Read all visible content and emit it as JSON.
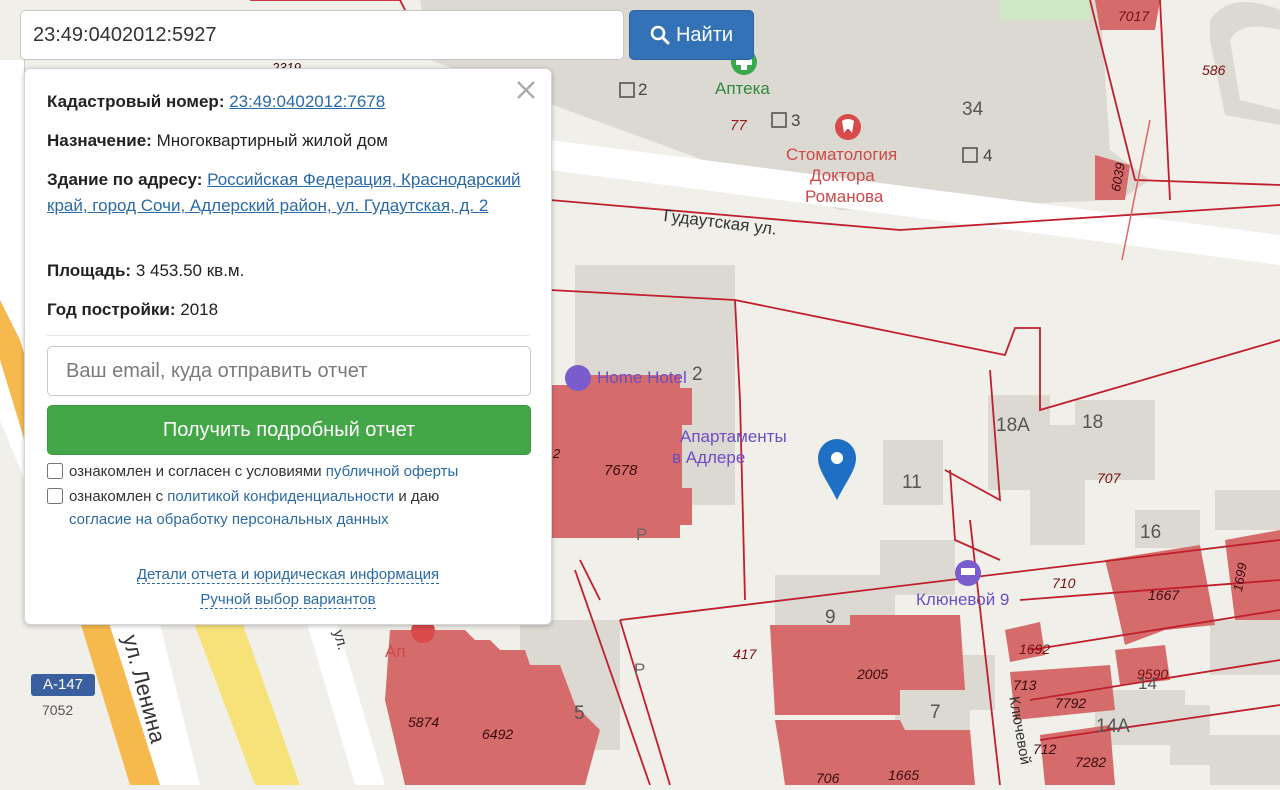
{
  "search": {
    "value": "23:49:0402012:5927",
    "button_label": "Найти"
  },
  "popup": {
    "cadastral_label": "Кадастровый номер:",
    "cadastral_value": "23:49:0402012:7678",
    "purpose_label": "Назначение:",
    "purpose_value": "Многоквартирный жилой дом",
    "address_label": "Здание по адресу:",
    "address_value": "Российская Федерация, Краснодарский край, город Сочи, Адлерский район, ул. Гудаутская, д. 2",
    "area_label": "Площадь:",
    "area_value": "3 453.50 кв.м.",
    "year_label": "Год постройки:",
    "year_value": "2018",
    "email_placeholder": "Ваш email, куда отправить отчет",
    "report_button": "Получить подробный отчет",
    "consent1_text": "ознакомлен и согласен с условиями",
    "consent1_link": "публичной оферты",
    "consent2_text1": "ознакомлен с",
    "consent2_link1": "политикой конфиденциальности",
    "consent2_text2": "и даю",
    "consent2_link2": "согласие на обработку персональных данных",
    "details_link": "Детали отчета и юридическая информация",
    "manual_link": "Ручной выбор вариантов"
  },
  "map": {
    "colors": {
      "background": "#f1efea",
      "building": "#dcd8d2",
      "parcel_fill": "#d56b6b",
      "parcel_line": "#c01f2c",
      "road": "#ffffff",
      "highway": "#f5b94d",
      "poi_green": "#3aa84f",
      "poi_red": "#d94b4b",
      "poi_purple": "#7a5ccc",
      "pin": "#1f6fc5"
    },
    "labels": [
      {
        "text": "Аптека",
        "color": "#2f8a3c",
        "size": 17
      },
      {
        "text": "77",
        "color": "#9a1b1b",
        "size": 15,
        "italic": true
      },
      {
        "text": "2",
        "color": "#444",
        "size": 17
      },
      {
        "text": "3",
        "color": "#444",
        "size": 17
      },
      {
        "text": "4",
        "color": "#444",
        "size": 17
      },
      {
        "text": "34",
        "color": "#555",
        "size": 19
      },
      {
        "text": "Стоматология",
        "color": "#cc4a4a",
        "size": 17
      },
      {
        "text": "Доктора",
        "color": "#cc4a4a",
        "size": 17
      },
      {
        "text": "Романова",
        "color": "#cc4a4a",
        "size": 17
      },
      {
        "text": "Гудаутская ул.",
        "color": "#333",
        "size": 17
      },
      {
        "text": "7017",
        "color": "#7a0e0e",
        "size": 14,
        "italic": true
      },
      {
        "text": "586",
        "color": "#7a0e0e",
        "size": 14,
        "italic": true
      },
      {
        "text": "Home Hotel",
        "color": "#6a4fc4",
        "size": 17
      },
      {
        "text": "2",
        "color": "#555",
        "size": 19
      },
      {
        "text": "Апартаменты",
        "color": "#6a4fc4",
        "size": 17
      },
      {
        "text": "в Адлере",
        "color": "#6a4fc4",
        "size": 17
      },
      {
        "text": "7678",
        "color": "#3a0a0a",
        "size": 15,
        "italic": true
      },
      {
        "text": "11",
        "color": "#555",
        "size": 19
      },
      {
        "text": "18А",
        "color": "#555",
        "size": 19
      },
      {
        "text": "18",
        "color": "#555",
        "size": 19
      },
      {
        "text": "707",
        "color": "#7a0e0e",
        "size": 14,
        "italic": true
      },
      {
        "text": "16",
        "color": "#555",
        "size": 19
      },
      {
        "text": "Клюневой 9",
        "color": "#6a4fc4",
        "size": 17
      },
      {
        "text": "710",
        "color": "#7a0e0e",
        "size": 14,
        "italic": true
      },
      {
        "text": "1667",
        "color": "#3a0a0a",
        "size": 14,
        "italic": true
      },
      {
        "text": "9",
        "color": "#555",
        "size": 19
      },
      {
        "text": "417",
        "color": "#7a0e0e",
        "size": 14,
        "italic": true
      },
      {
        "text": "2005",
        "color": "#3a0a0a",
        "size": 14,
        "italic": true
      },
      {
        "text": "1692",
        "color": "#7a0e0e",
        "size": 14,
        "italic": true
      },
      {
        "text": "9590",
        "color": "#7a0e0e",
        "size": 14,
        "italic": true
      },
      {
        "text": "713",
        "color": "#3a0a0a",
        "size": 14,
        "italic": true
      },
      {
        "text": "7792",
        "color": "#3a0a0a",
        "size": 14,
        "italic": true
      },
      {
        "text": "7",
        "color": "#555",
        "size": 19
      },
      {
        "text": "14А",
        "color": "#555",
        "size": 19
      },
      {
        "text": "712",
        "color": "#3a0a0a",
        "size": 14,
        "italic": true
      },
      {
        "text": "7282",
        "color": "#3a0a0a",
        "size": 14,
        "italic": true
      },
      {
        "text": "706",
        "color": "#3a0a0a",
        "size": 14,
        "italic": true
      },
      {
        "text": "1665",
        "color": "#3a0a0a",
        "size": 14,
        "italic": true
      },
      {
        "text": "5",
        "color": "#555",
        "size": 19
      },
      {
        "text": "5874",
        "color": "#3a0a0a",
        "size": 14,
        "italic": true
      },
      {
        "text": "6492",
        "color": "#3a0a0a",
        "size": 14,
        "italic": true
      },
      {
        "text": "7052",
        "color": "#555",
        "size": 14
      },
      {
        "text": "6039",
        "color": "#3a0a0a",
        "size": 13,
        "italic": true
      },
      {
        "text": "1699",
        "color": "#3a0a0a",
        "size": 13,
        "italic": true
      },
      {
        "text": "P",
        "color": "#666",
        "size": 17
      },
      {
        "text": "P",
        "color": "#666",
        "size": 17
      },
      {
        "text": "ул. Ленина",
        "color": "#333",
        "size": 22
      },
      {
        "text": "Ключевой",
        "color": "#333",
        "size": 15
      },
      {
        "text": "ул.",
        "color": "#333",
        "size": 15
      },
      {
        "text": "2319",
        "color": "#3a0a0a",
        "size": 13,
        "italic": true
      },
      {
        "text": "2",
        "color": "#3a0a0a",
        "size": 13,
        "italic": true
      },
      {
        "text": "14",
        "color": "#555",
        "size": 17
      },
      {
        "text": "Ап",
        "color": "#cc4a4a",
        "size": 17
      }
    ],
    "road_badge": "А-147"
  }
}
